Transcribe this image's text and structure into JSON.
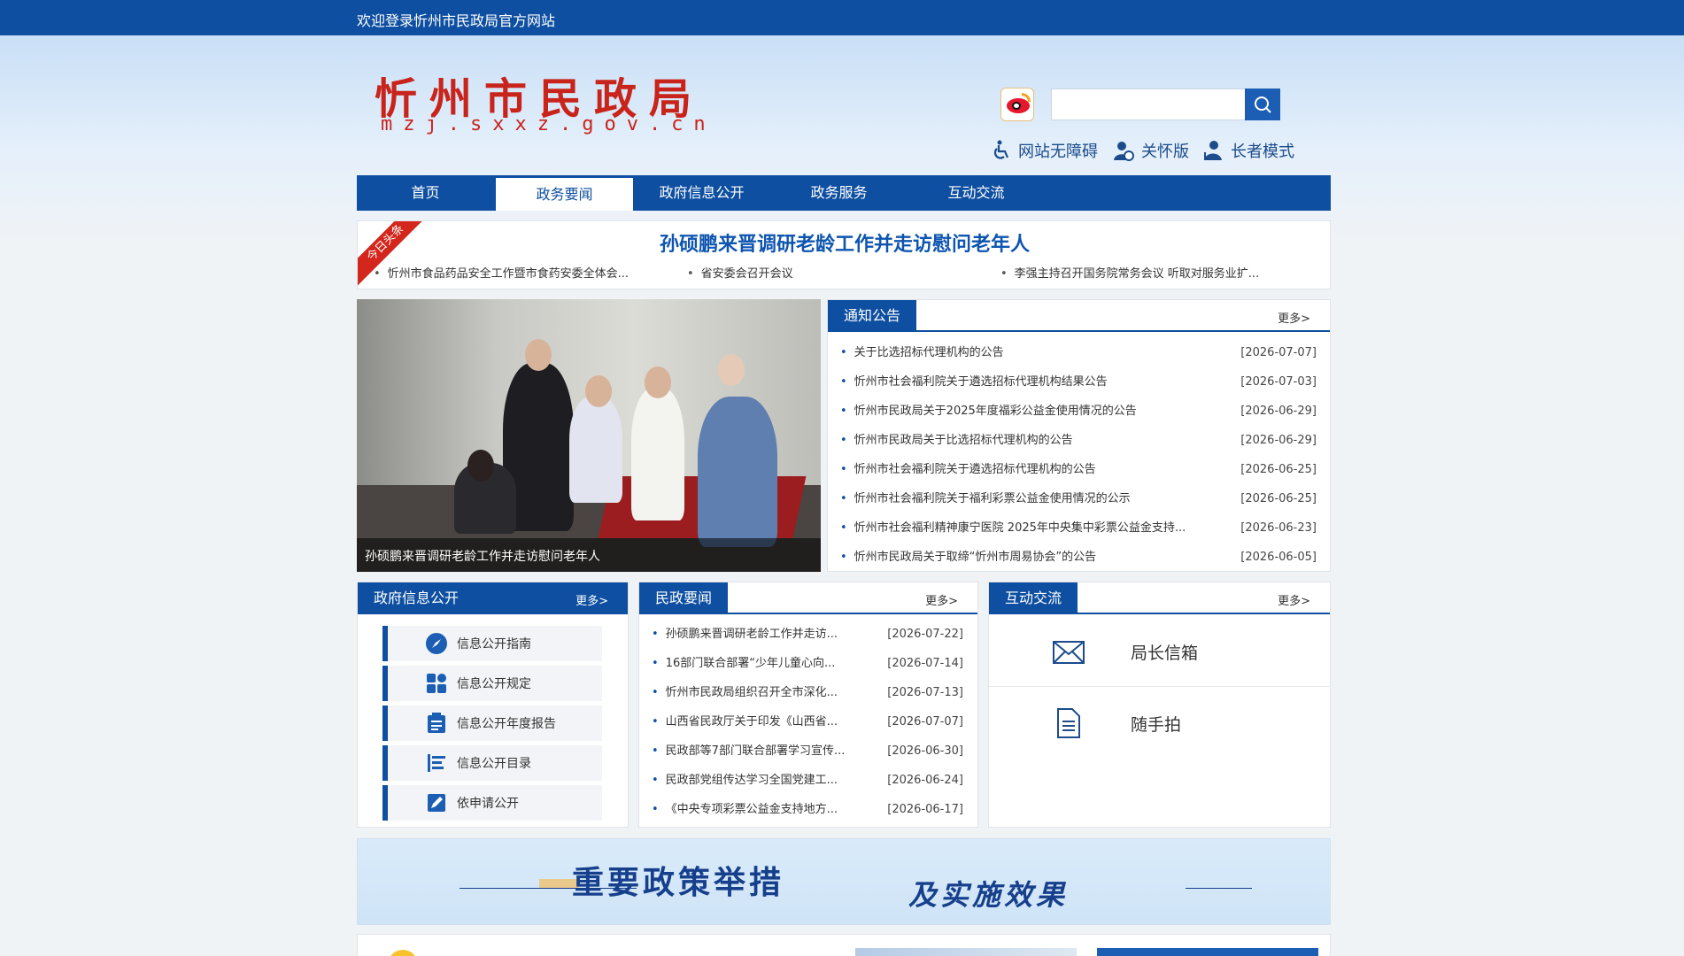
{
  "topbar": {
    "welcome": "欢迎登录忻州市民政局官方网站"
  },
  "header": {
    "logo_cn": "忻州市民政局",
    "logo_en": "mzj.sxxz.gov.cn",
    "search": {
      "placeholder": "",
      "value": ""
    },
    "tools": [
      {
        "label": "网站无障碍",
        "icon": "wheelchair-icon"
      },
      {
        "label": "关怀版",
        "icon": "care-user-icon"
      },
      {
        "label": "长者模式",
        "icon": "elder-user-icon"
      }
    ]
  },
  "nav": {
    "items": [
      "首页",
      "政务要闻",
      "政府信息公开",
      "政务服务",
      "互动交流"
    ],
    "active": "政务要闻"
  },
  "headline": {
    "ribbon": "今日头条",
    "title": "孙硕鹏来晋调研老龄工作并走访慰问老年人",
    "sub": [
      "忻州市食品药品安全工作暨市食药安委全体会...",
      "省安委会召开会议",
      "李强主持召开国务院常务会议 听取对服务业扩..."
    ]
  },
  "slider": {
    "caption": "孙硕鹏来晋调研老龄工作并走访慰问老年人",
    "dot_count": 6,
    "active_dot": 3
  },
  "notice": {
    "title": "通知公告",
    "more": "更多>",
    "items": [
      {
        "text": "关于比选招标代理机构的公告",
        "date": "[2026-07-07]"
      },
      {
        "text": "忻州市社会福利院关于遴选招标代理机构结果公告",
        "date": "[2026-07-03]"
      },
      {
        "text": "忻州市民政局关于2025年度福彩公益金使用情况的公告",
        "date": "[2026-06-29]"
      },
      {
        "text": "忻州市民政局关于比选招标代理机构的公告",
        "date": "[2026-06-29]"
      },
      {
        "text": "忻州市社会福利院关于遴选招标代理机构的公告",
        "date": "[2026-06-25]"
      },
      {
        "text": "忻州市社会福利院关于福利彩票公益金使用情况的公示",
        "date": "[2026-06-25]"
      },
      {
        "text": "忻州市社会福利精神康宁医院 2025年中央集中彩票公益金支持...",
        "date": "[2026-06-23]"
      },
      {
        "text": "忻州市民政局关于取缔“忻州市周易协会”的公告",
        "date": "[2026-06-05]"
      }
    ]
  },
  "gov_info": {
    "title": "政府信息公开",
    "more": "更多>",
    "items": [
      {
        "label": "信息公开指南",
        "icon": "compass-icon"
      },
      {
        "label": "信息公开规定",
        "icon": "grid-blocks-icon"
      },
      {
        "label": "信息公开年度报告",
        "icon": "clipboard-icon"
      },
      {
        "label": "信息公开目录",
        "icon": "list-icon"
      },
      {
        "label": "依申请公开",
        "icon": "edit-icon"
      }
    ]
  },
  "civil_news": {
    "title": "民政要闻",
    "more": "更多>",
    "items": [
      {
        "text": "孙硕鹏来晋调研老龄工作并走访...",
        "date": "[2026-07-22]"
      },
      {
        "text": "16部门联合部署“少年儿童心向...",
        "date": "[2026-07-14]"
      },
      {
        "text": "忻州市民政局组织召开全市深化...",
        "date": "[2026-07-13]"
      },
      {
        "text": "山西省民政厅关于印发《山西省...",
        "date": "[2026-07-07]"
      },
      {
        "text": "民政部等7部门联合部署学习宣传...",
        "date": "[2026-06-30]"
      },
      {
        "text": "民政部党组传达学习全国党建工...",
        "date": "[2026-06-24]"
      },
      {
        "text": "《中央专项彩票公益金支持地方...",
        "date": "[2026-06-17]"
      }
    ]
  },
  "interaction": {
    "title": "互动交流",
    "more": "更多>",
    "items": [
      {
        "label": "局长信箱",
        "icon": "mail-icon"
      },
      {
        "label": "随手拍",
        "icon": "document-icon"
      }
    ]
  },
  "banner": {
    "main": "重要政策举措",
    "sub": "及实施效果"
  },
  "colors": {
    "primary": "#0e4fa1",
    "logo_red": "#c9241b",
    "headline_blue": "#0e55b0"
  }
}
